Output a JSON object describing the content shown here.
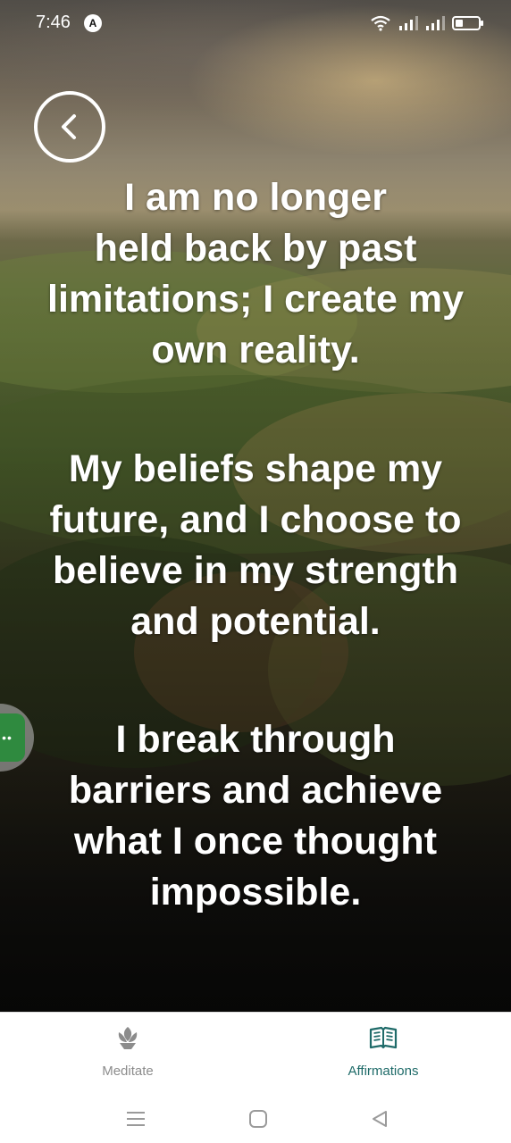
{
  "status_bar": {
    "time": "7:46",
    "app_badge": "A",
    "battery_level": 0.35
  },
  "affirmations": [
    "I am no longer\nheld back by past\nlimitations; I create my\nown reality.",
    " My beliefs shape my\nfuture, and I choose to\nbelieve in my strength\nand potential.",
    " I break through\nbarriers and achieve\nwhat I once thought\nimpossible."
  ],
  "bottom_nav": {
    "items": [
      {
        "label": "Meditate",
        "icon": "lotus-icon",
        "active": false
      },
      {
        "label": "Affirmations",
        "icon": "open-book-icon",
        "active": true
      }
    ],
    "active_color": "#1f6b69",
    "inactive_color": "#8c8c8c"
  },
  "floating_bubble": {
    "icon": "chat-bubble-icon",
    "color": "#2f8a3f"
  },
  "system_nav": {
    "icons": [
      "menu-icon",
      "home-icon",
      "back-triangle-icon"
    ]
  }
}
